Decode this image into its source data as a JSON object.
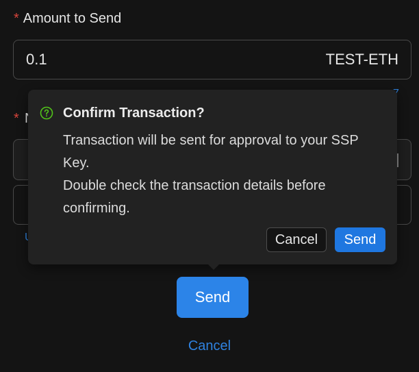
{
  "form": {
    "amount_label": "Amount to Send",
    "amount_value": "0.1",
    "amount_suffix": "TEST-ETH",
    "obscured_link_right": "7",
    "obscured_label_fragment": "N",
    "obscured_link_left": "U"
  },
  "popconfirm": {
    "icon": "question-circle-icon",
    "title": "Confirm Transaction?",
    "description_line1": "Transaction will be sent for approval to your SSP Key.",
    "description_line2": "Double check the transaction details before confirming.",
    "cancel_label": "Cancel",
    "send_label": "Send"
  },
  "actions": {
    "send_label": "Send",
    "cancel_label": "Cancel"
  },
  "colors": {
    "background": "#141414",
    "primary": "#2c84e8",
    "required": "#d8453c",
    "success_icon": "#52c41a"
  }
}
